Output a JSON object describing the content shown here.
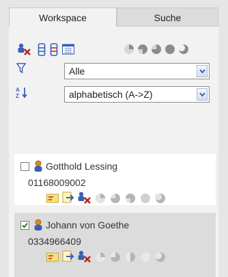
{
  "tabs": [
    {
      "label": "Workspace",
      "active": true
    },
    {
      "label": "Suche",
      "active": false
    }
  ],
  "toolbar": {
    "icons": [
      "person-delete-icon",
      "column-1-icon",
      "column-2-icon",
      "calendar-grid-icon",
      "status-filter-icons"
    ]
  },
  "filter": {
    "selected": "Alle"
  },
  "sort": {
    "selected": "alphabetisch (A->Z)"
  },
  "contacts": [
    {
      "name": "Gotthold Lessing",
      "phone": "01168009002",
      "checked": false
    },
    {
      "name": "Johann von Goethe",
      "phone": "0334966409",
      "checked": true
    }
  ],
  "colors": {
    "accent_blue": "#3a5fb5",
    "accent_red": "#c0221d",
    "status_gray": "#b5b5b5",
    "card_selected_bg": "#dcdcdc",
    "panel_bg": "#f2f2f2"
  }
}
